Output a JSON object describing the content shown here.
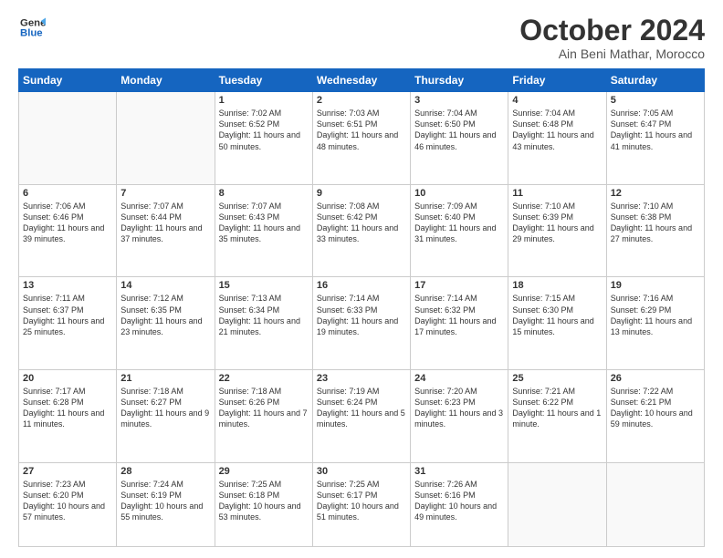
{
  "header": {
    "logo_line1": "General",
    "logo_line2": "Blue",
    "month": "October 2024",
    "location": "Ain Beni Mathar, Morocco"
  },
  "days_of_week": [
    "Sunday",
    "Monday",
    "Tuesday",
    "Wednesday",
    "Thursday",
    "Friday",
    "Saturday"
  ],
  "weeks": [
    [
      {
        "day": "",
        "info": ""
      },
      {
        "day": "",
        "info": ""
      },
      {
        "day": "1",
        "info": "Sunrise: 7:02 AM\nSunset: 6:52 PM\nDaylight: 11 hours and 50 minutes."
      },
      {
        "day": "2",
        "info": "Sunrise: 7:03 AM\nSunset: 6:51 PM\nDaylight: 11 hours and 48 minutes."
      },
      {
        "day": "3",
        "info": "Sunrise: 7:04 AM\nSunset: 6:50 PM\nDaylight: 11 hours and 46 minutes."
      },
      {
        "day": "4",
        "info": "Sunrise: 7:04 AM\nSunset: 6:48 PM\nDaylight: 11 hours and 43 minutes."
      },
      {
        "day": "5",
        "info": "Sunrise: 7:05 AM\nSunset: 6:47 PM\nDaylight: 11 hours and 41 minutes."
      }
    ],
    [
      {
        "day": "6",
        "info": "Sunrise: 7:06 AM\nSunset: 6:46 PM\nDaylight: 11 hours and 39 minutes."
      },
      {
        "day": "7",
        "info": "Sunrise: 7:07 AM\nSunset: 6:44 PM\nDaylight: 11 hours and 37 minutes."
      },
      {
        "day": "8",
        "info": "Sunrise: 7:07 AM\nSunset: 6:43 PM\nDaylight: 11 hours and 35 minutes."
      },
      {
        "day": "9",
        "info": "Sunrise: 7:08 AM\nSunset: 6:42 PM\nDaylight: 11 hours and 33 minutes."
      },
      {
        "day": "10",
        "info": "Sunrise: 7:09 AM\nSunset: 6:40 PM\nDaylight: 11 hours and 31 minutes."
      },
      {
        "day": "11",
        "info": "Sunrise: 7:10 AM\nSunset: 6:39 PM\nDaylight: 11 hours and 29 minutes."
      },
      {
        "day": "12",
        "info": "Sunrise: 7:10 AM\nSunset: 6:38 PM\nDaylight: 11 hours and 27 minutes."
      }
    ],
    [
      {
        "day": "13",
        "info": "Sunrise: 7:11 AM\nSunset: 6:37 PM\nDaylight: 11 hours and 25 minutes."
      },
      {
        "day": "14",
        "info": "Sunrise: 7:12 AM\nSunset: 6:35 PM\nDaylight: 11 hours and 23 minutes."
      },
      {
        "day": "15",
        "info": "Sunrise: 7:13 AM\nSunset: 6:34 PM\nDaylight: 11 hours and 21 minutes."
      },
      {
        "day": "16",
        "info": "Sunrise: 7:14 AM\nSunset: 6:33 PM\nDaylight: 11 hours and 19 minutes."
      },
      {
        "day": "17",
        "info": "Sunrise: 7:14 AM\nSunset: 6:32 PM\nDaylight: 11 hours and 17 minutes."
      },
      {
        "day": "18",
        "info": "Sunrise: 7:15 AM\nSunset: 6:30 PM\nDaylight: 11 hours and 15 minutes."
      },
      {
        "day": "19",
        "info": "Sunrise: 7:16 AM\nSunset: 6:29 PM\nDaylight: 11 hours and 13 minutes."
      }
    ],
    [
      {
        "day": "20",
        "info": "Sunrise: 7:17 AM\nSunset: 6:28 PM\nDaylight: 11 hours and 11 minutes."
      },
      {
        "day": "21",
        "info": "Sunrise: 7:18 AM\nSunset: 6:27 PM\nDaylight: 11 hours and 9 minutes."
      },
      {
        "day": "22",
        "info": "Sunrise: 7:18 AM\nSunset: 6:26 PM\nDaylight: 11 hours and 7 minutes."
      },
      {
        "day": "23",
        "info": "Sunrise: 7:19 AM\nSunset: 6:24 PM\nDaylight: 11 hours and 5 minutes."
      },
      {
        "day": "24",
        "info": "Sunrise: 7:20 AM\nSunset: 6:23 PM\nDaylight: 11 hours and 3 minutes."
      },
      {
        "day": "25",
        "info": "Sunrise: 7:21 AM\nSunset: 6:22 PM\nDaylight: 11 hours and 1 minute."
      },
      {
        "day": "26",
        "info": "Sunrise: 7:22 AM\nSunset: 6:21 PM\nDaylight: 10 hours and 59 minutes."
      }
    ],
    [
      {
        "day": "27",
        "info": "Sunrise: 7:23 AM\nSunset: 6:20 PM\nDaylight: 10 hours and 57 minutes."
      },
      {
        "day": "28",
        "info": "Sunrise: 7:24 AM\nSunset: 6:19 PM\nDaylight: 10 hours and 55 minutes."
      },
      {
        "day": "29",
        "info": "Sunrise: 7:25 AM\nSunset: 6:18 PM\nDaylight: 10 hours and 53 minutes."
      },
      {
        "day": "30",
        "info": "Sunrise: 7:25 AM\nSunset: 6:17 PM\nDaylight: 10 hours and 51 minutes."
      },
      {
        "day": "31",
        "info": "Sunrise: 7:26 AM\nSunset: 6:16 PM\nDaylight: 10 hours and 49 minutes."
      },
      {
        "day": "",
        "info": ""
      },
      {
        "day": "",
        "info": ""
      }
    ]
  ]
}
